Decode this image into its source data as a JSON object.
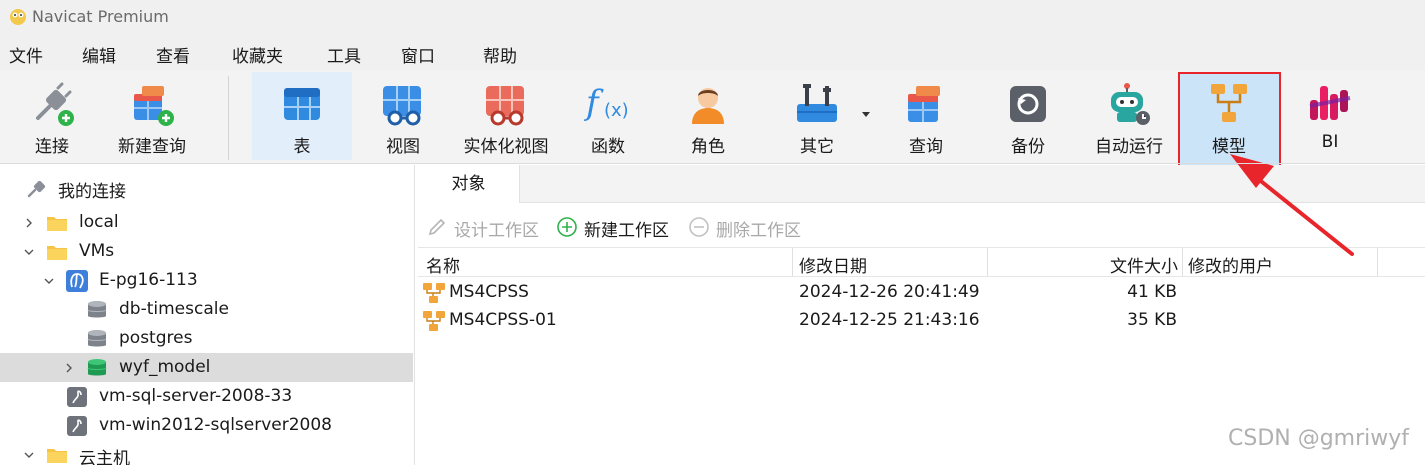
{
  "titlebar": {
    "title": "Navicat Premium",
    "logo_icon": "navicat-logo-icon"
  },
  "menubar": {
    "items": [
      "文件",
      "编辑",
      "查看",
      "收藏夹",
      "工具",
      "窗口",
      "帮助"
    ]
  },
  "toolbar": {
    "buttons": [
      {
        "label": "连接",
        "icon": "plug-plus-icon"
      },
      {
        "label": "新建查询",
        "icon": "new-query-icon"
      },
      {
        "label": "表",
        "icon": "table-icon",
        "active": true
      },
      {
        "label": "视图",
        "icon": "view-glasses-icon"
      },
      {
        "label": "实体化视图",
        "icon": "materialized-view-icon"
      },
      {
        "label": "函数",
        "icon": "function-fx-icon"
      },
      {
        "label": "角色",
        "icon": "role-person-icon"
      },
      {
        "label": "其它",
        "icon": "tools-icon",
        "has_dropdown": true
      },
      {
        "label": "查询",
        "icon": "query-icon"
      },
      {
        "label": "备份",
        "icon": "backup-icon"
      },
      {
        "label": "自动运行",
        "icon": "robot-icon"
      },
      {
        "label": "模型",
        "icon": "model-diagram-icon",
        "highlighted": true
      },
      {
        "label": "BI",
        "icon": "bi-chart-icon"
      }
    ]
  },
  "sidebar": {
    "header": "我的连接",
    "tree": [
      {
        "label": "我的连接",
        "icon": "connection-plug-icon",
        "level": 0
      },
      {
        "label": "local",
        "icon": "folder-icon",
        "level": 1,
        "expanded": false
      },
      {
        "label": "VMs",
        "icon": "folder-icon",
        "level": 1,
        "expanded": true
      },
      {
        "label": "E-pg16-113",
        "icon": "postgres-elephant-icon",
        "level": 2,
        "expanded": true
      },
      {
        "label": "db-timescale",
        "icon": "database-icon",
        "level": 3
      },
      {
        "label": "postgres",
        "icon": "database-icon",
        "level": 3
      },
      {
        "label": "wyf_model",
        "icon": "database-active-icon",
        "level": 3,
        "selected": true
      },
      {
        "label": "vm-sql-server-2008-33",
        "icon": "sqlserver-icon",
        "level": 2
      },
      {
        "label": "vm-win2012-sqlserver2008",
        "icon": "sqlserver-icon",
        "level": 2
      },
      {
        "label": "云主机",
        "icon": "folder-icon",
        "level": 1,
        "expanded": true
      }
    ]
  },
  "tabs": {
    "objects": "对象"
  },
  "subtoolbar": {
    "design": "设计工作区",
    "new": "新建工作区",
    "delete": "删除工作区"
  },
  "grid": {
    "columns": [
      "名称",
      "修改日期",
      "文件大小",
      "修改的用户"
    ],
    "rows": [
      {
        "name": "MS4CPSS",
        "modified": "2024-12-26 20:41:49",
        "size": "41 KB",
        "user": ""
      },
      {
        "name": "MS4CPSS-01",
        "modified": "2024-12-25 21:43:16",
        "size": "35 KB",
        "user": ""
      }
    ]
  },
  "watermark": "CSDN @gmriwyf",
  "colors": {
    "highlight_red": "#e8252b",
    "selected_blue": "#cce4f7",
    "active_tab": "#e3eefb"
  }
}
